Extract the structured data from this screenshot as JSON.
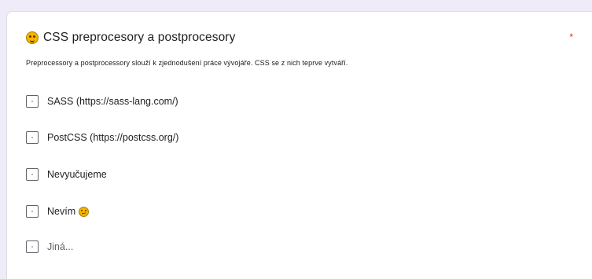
{
  "question": {
    "title": "CSS preprocesory a postprocesory",
    "title_icon": "thinking-face-icon",
    "required_marker": "*",
    "description": "Preprocessory a postprocessory slouží k zjednodušení práce vývojáře. CSS se z nich teprve vytváří."
  },
  "options": [
    {
      "label": "SASS (https://sass-lang.com/)",
      "checked": false
    },
    {
      "label": "PostCSS (https://postcss.org/)",
      "checked": false
    },
    {
      "label": "Nevyučujeme",
      "checked": false
    },
    {
      "label": "Nevím",
      "icon": "thinking-face-icon",
      "checked": false
    },
    {
      "label": "Jiná...",
      "checked": false
    }
  ],
  "colors": {
    "background": "#f0ebf8",
    "card": "#ffffff",
    "required": "#d93025",
    "text": "#202124",
    "muted": "#5f6368"
  }
}
